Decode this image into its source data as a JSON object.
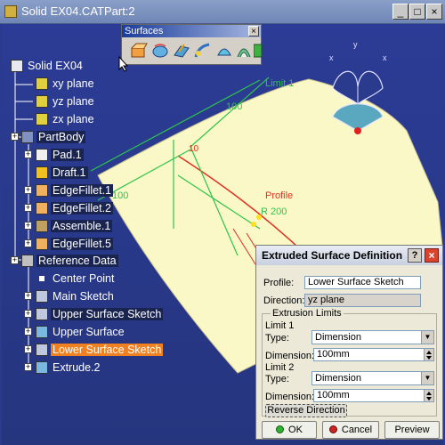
{
  "window": {
    "title": "Solid EX04.CATPart:2",
    "buttons": {
      "minimize": "_",
      "maximize": "□",
      "close": "×"
    }
  },
  "toolbar": {
    "title": "Surfaces",
    "close": "×",
    "icons": [
      "extrude-icon",
      "revolve-icon",
      "offset-icon",
      "sweep-icon",
      "fill-icon",
      "loft-icon",
      "blend-icon"
    ]
  },
  "tree": {
    "root": "Solid EX04",
    "items": [
      {
        "label": "xy plane",
        "icon": "plane-icon"
      },
      {
        "label": "yz plane",
        "icon": "plane-icon"
      },
      {
        "label": "zx plane",
        "icon": "plane-icon"
      },
      {
        "label": "PartBody",
        "icon": "body-icon"
      },
      {
        "label": "Pad.1",
        "icon": "pad-icon"
      },
      {
        "label": "Draft.1",
        "icon": "draft-icon"
      },
      {
        "label": "EdgeFillet.1",
        "icon": "fillet-icon"
      },
      {
        "label": "EdgeFillet.2",
        "icon": "fillet-icon"
      },
      {
        "label": "Assemble.1",
        "icon": "assemble-icon"
      },
      {
        "label": "EdgeFillet.5",
        "icon": "fillet-icon"
      },
      {
        "label": "Reference Data",
        "icon": "geoset-icon"
      },
      {
        "label": "Center Point",
        "icon": "point-icon"
      },
      {
        "label": "Main Sketch",
        "icon": "sketch-icon"
      },
      {
        "label": "Upper Surface Sketch",
        "icon": "sketch-icon"
      },
      {
        "label": "Upper Surface",
        "icon": "surface-icon"
      },
      {
        "label": "Lower Surface Sketch",
        "icon": "sketch-icon"
      },
      {
        "label": "Extrude.2",
        "icon": "extrude-icon"
      }
    ]
  },
  "scene": {
    "labels": {
      "limit1": "Limit 1",
      "dim_top": "100",
      "dim_left": "100",
      "dim_small": "10",
      "profile": "Profile",
      "radius": "R 200"
    },
    "compass_axes": {
      "x": "x",
      "y": "y"
    }
  },
  "dialog": {
    "title": "Extruded Surface Definition",
    "help": "?",
    "close": "×",
    "profile_label": "Profile:",
    "profile_value": "Lower Surface Sketch",
    "direction_label": "Direction:",
    "direction_value": "yz plane",
    "extrusion_limits": "Extrusion Limits",
    "limit1": {
      "heading": "Limit 1",
      "type_label": "Type:",
      "type_value": "Dimension",
      "dimension_label": "Dimension:",
      "dimension_value": "100mm"
    },
    "limit2": {
      "heading": "Limit 2",
      "type_label": "Type:",
      "type_value": "Dimension",
      "dimension_label": "Dimension:",
      "dimension_value": "100mm"
    },
    "reverse_direction": "Reverse Direction",
    "ok": "OK",
    "cancel": "Cancel",
    "preview": "Preview"
  },
  "colors": {
    "background": "#2a3a8c",
    "surface": "#fbf8c8",
    "dimension_green": "#2cc44a",
    "selection_orange": "#f08020",
    "profile_red": "#e03020"
  }
}
